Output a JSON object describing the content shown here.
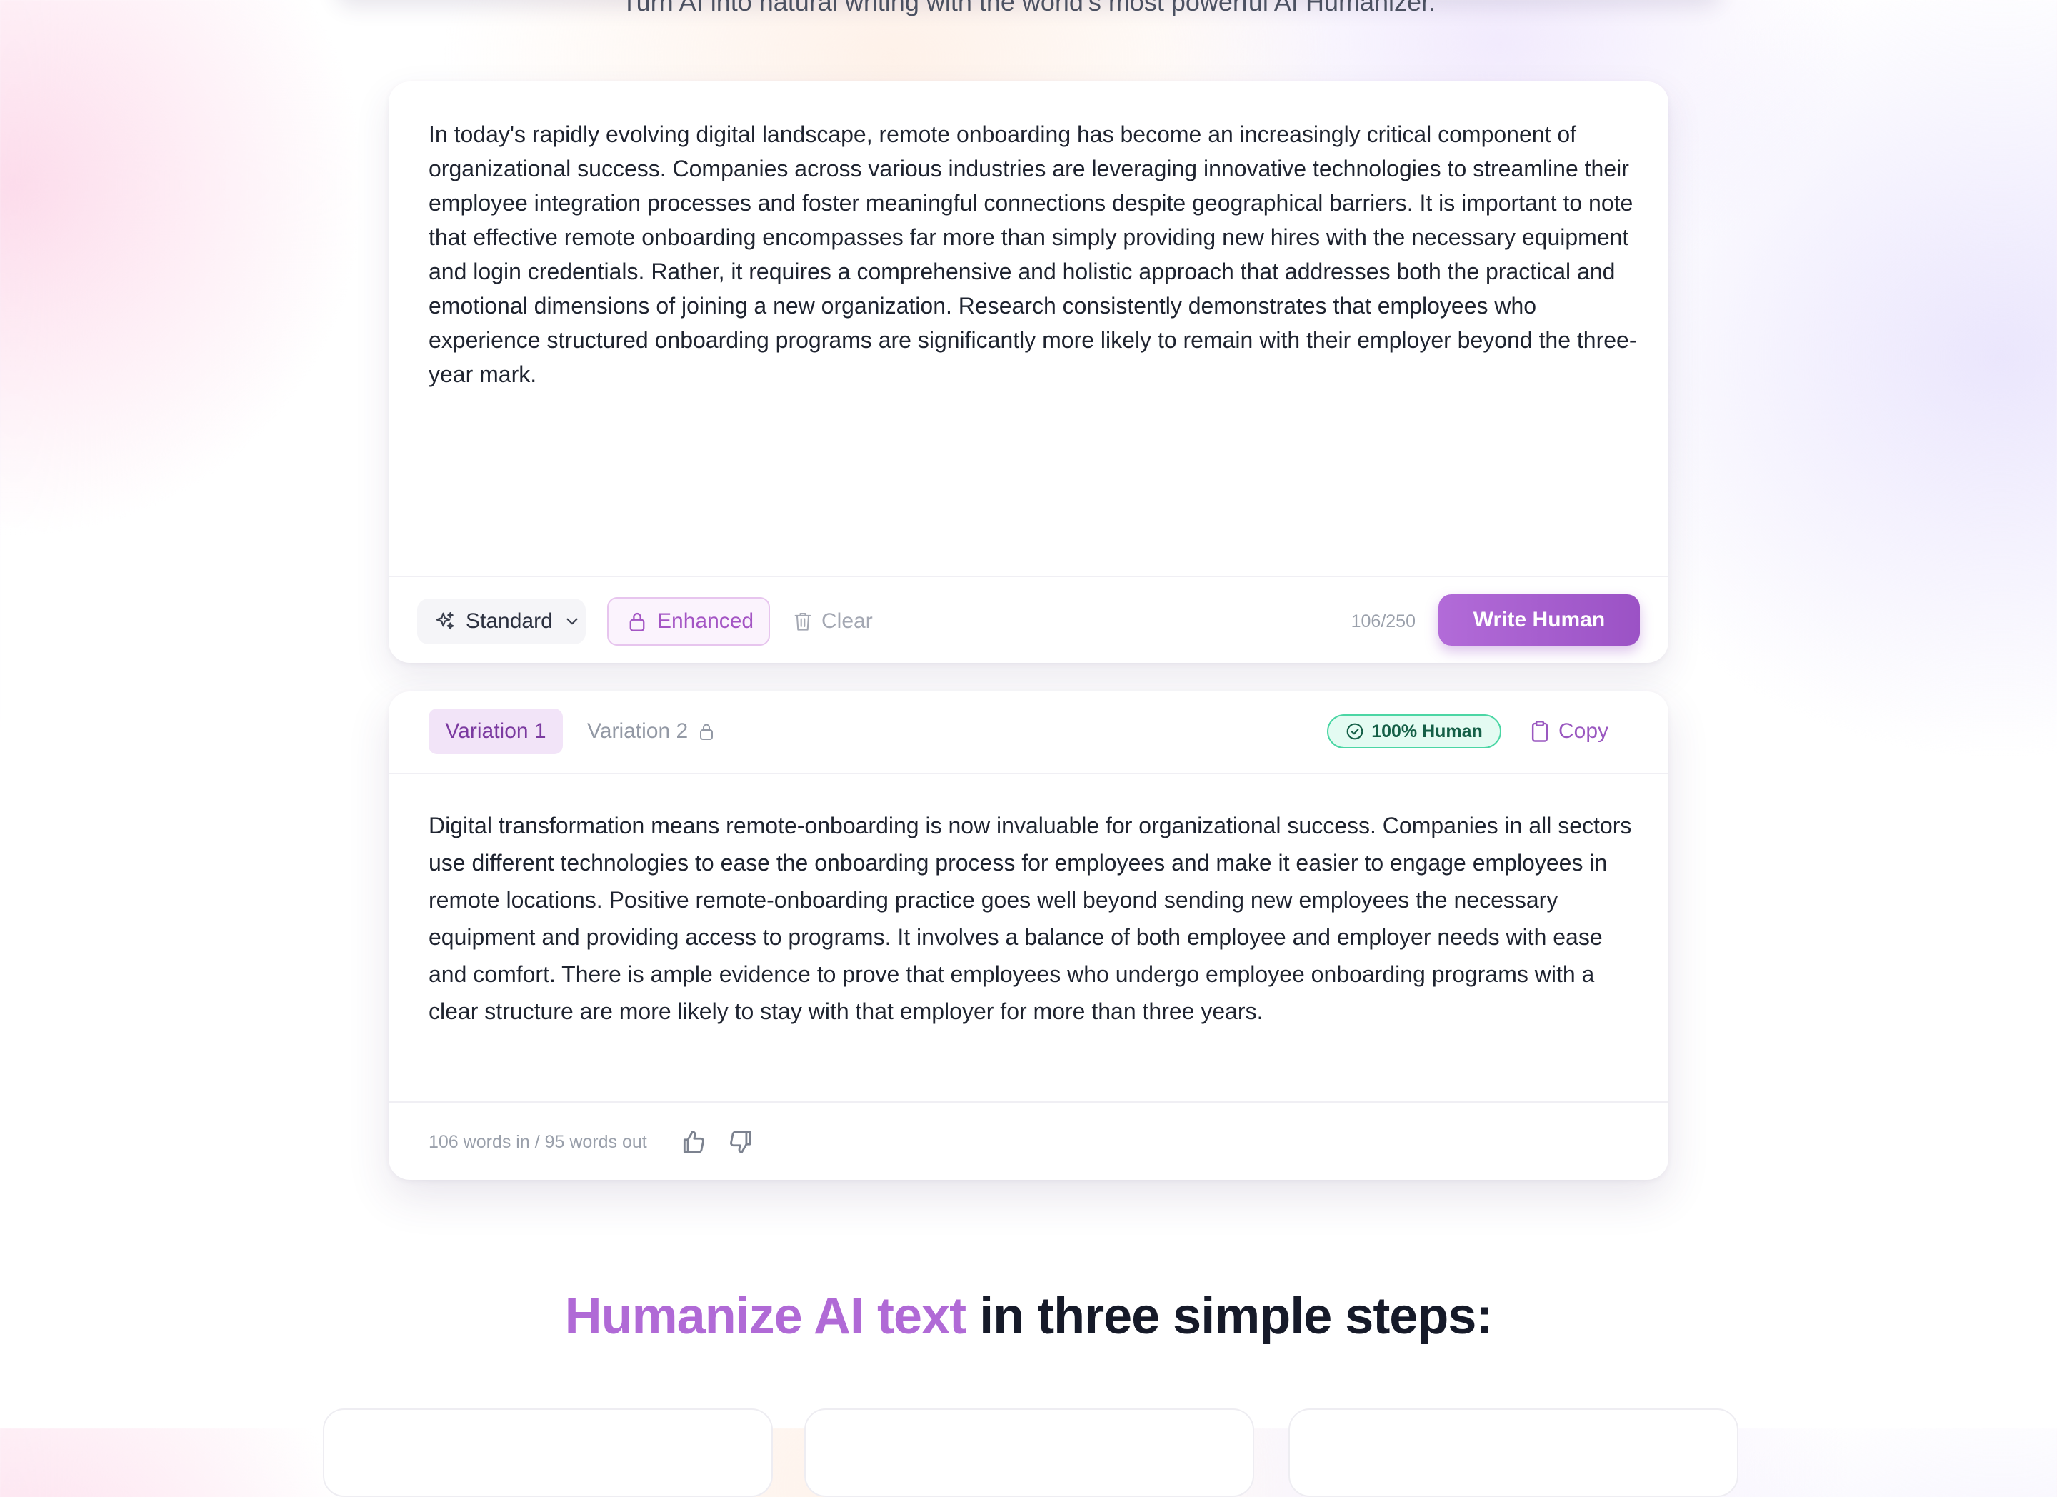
{
  "header": {
    "subtitle": "Turn AI into natural writing with the world's most powerful AI Humanizer."
  },
  "input": {
    "text": "In today's rapidly evolving digital landscape, remote onboarding has become an increasingly critical component of organizational success. Companies across various industries are leveraging innovative technologies to streamline their employee integration processes and foster meaningful connections despite geographical barriers. It is important to note that effective remote onboarding encompasses far more than simply providing new hires with the necessary equipment and login credentials. Rather, it requires a comprehensive and holistic approach that addresses both the practical and emotional dimensions of joining a new organization. Research consistently demonstrates that employees who experience structured onboarding programs are significantly more likely to remain with their employer beyond the three-year mark.",
    "mode_label": "Standard",
    "enhanced_label": "Enhanced",
    "clear_label": "Clear",
    "char_count": "106/250",
    "submit_label": "Write Human"
  },
  "output": {
    "tabs": [
      {
        "label": "Variation 1",
        "active": true,
        "locked": false
      },
      {
        "label": "Variation 2",
        "active": false,
        "locked": true
      }
    ],
    "badge": "100% Human",
    "copy_label": "Copy",
    "text": "Digital transformation means remote-onboarding is now invaluable for organizational success. Companies in all sectors use different technologies to ease the onboarding process for employees and make it easier to engage employees in remote locations. Positive remote-onboarding practice goes well beyond sending new employees the necessary equipment and providing access to programs. It involves a balance of both employee and employer needs with ease and comfort. There is ample evidence to prove that employees who undergo employee onboarding programs with a clear structure are more likely to stay with that employer for more than three years.",
    "word_count": "106 words in / 95 words out"
  },
  "steps": {
    "heading_accent": "Humanize AI text",
    "heading_rest": "in three simple steps:"
  },
  "colors": {
    "accent": "#b06ad6",
    "button": "#9b52c5",
    "human_badge": "#4bd6a4"
  },
  "icons": {
    "mode": "sparkles-icon",
    "mode_dropdown": "chevron-down-icon",
    "enhanced": "lock-icon",
    "clear": "trash-icon",
    "variation2": "lock-icon",
    "badge": "check-circle-icon",
    "copy": "clipboard-icon",
    "feedback_up": "thumbs-up-icon",
    "feedback_down": "thumbs-down-icon"
  }
}
